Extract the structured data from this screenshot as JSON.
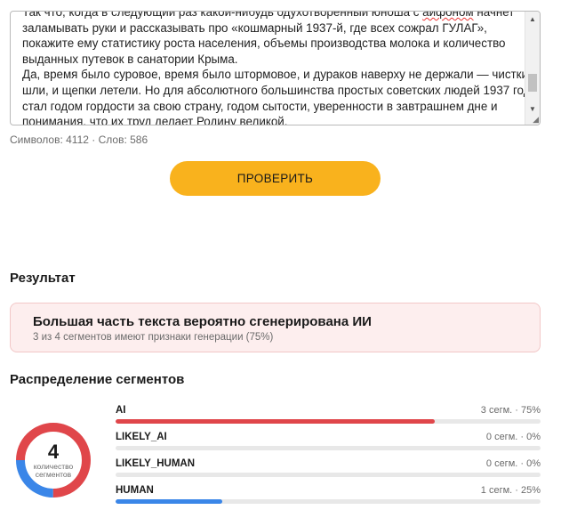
{
  "editor": {
    "paragraphs": [
      "Так что, когда в следующий раз какой-нибудь одухотворенный юноша с айфоном начнет",
      "заламывать руки и рассказывать про «кошмарный 1937-й, где всех сожрал ГУЛАГ»,",
      "покажите ему статистику роста населения, объемы производства молока и количество",
      "выданных путевок в санатории Крыма.",
      "Да, время было суровое, время было штормовое, и дураков наверху не держали — чистки",
      "шли, и щепки летели. Но для абсолютного большинства простых советских людей 1937 год",
      "стал годом гордости за свою страну, годом сытости, уверенности в завтрашнем дне и",
      "понимания, что их труд делает Родину великой."
    ],
    "misspelled_word": "айфоном"
  },
  "counter": {
    "text": "Символов: 4112 · Слов: 586"
  },
  "check_button": {
    "label": "ПРОВЕРИТЬ"
  },
  "result": {
    "title": "Результат",
    "headline": "Большая часть текста вероятно сгенерирована ИИ",
    "subtext": "3 из 4 сегментов имеют признаки генерации (75%)"
  },
  "distribution": {
    "title": "Распределение сегментов",
    "total": "4",
    "total_label": "количество сегментов",
    "segments": [
      {
        "name": "AI",
        "meta": "3 сегм. · 75%",
        "fraction": 0.75,
        "color": "#e0464a"
      },
      {
        "name": "LIKELY_AI",
        "meta": "0 сегм. · 0%",
        "fraction": 0,
        "color": "#f0a24b"
      },
      {
        "name": "LIKELY_HUMAN",
        "meta": "0 сегм. · 0%",
        "fraction": 0,
        "color": "#7fb2f0"
      },
      {
        "name": "HUMAN",
        "meta": "1 сегм. · 25%",
        "fraction": 0.25,
        "color": "#3a86e8"
      }
    ]
  },
  "colors": {
    "accent_button": "#f9b21d",
    "ai_red": "#e0464a",
    "human_blue": "#3a86e8",
    "result_bg": "#fdeeee"
  }
}
